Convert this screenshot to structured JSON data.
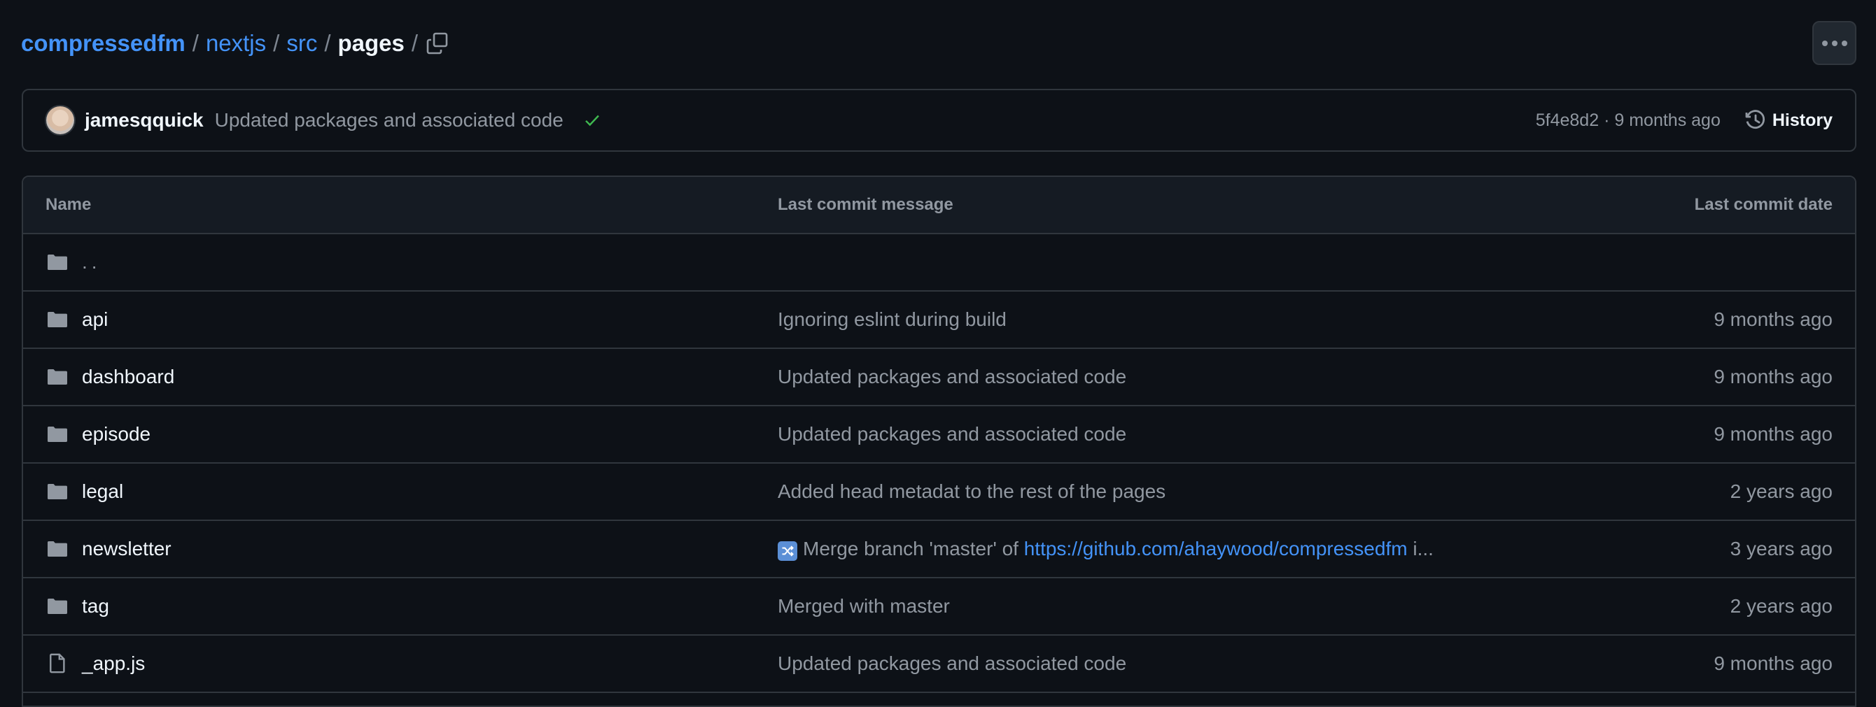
{
  "breadcrumb": {
    "items": [
      {
        "label": "compressedfm",
        "type": "repo"
      },
      {
        "label": "nextjs",
        "type": "dir"
      },
      {
        "label": "src",
        "type": "dir"
      }
    ],
    "current": "pages",
    "separator": "/"
  },
  "icons": {
    "copy": "copy-path-icon",
    "more": "kebab-horizontal-icon"
  },
  "latest_commit": {
    "author": "jamesqquick",
    "message": "Updated packages and associated code",
    "status": "success",
    "sha": "5f4e8d2",
    "separator": "·",
    "time": "9 months ago",
    "history_label": "History"
  },
  "table": {
    "headers": {
      "name": "Name",
      "message": "Last commit message",
      "date": "Last commit date"
    },
    "rows": [
      {
        "type": "parent",
        "name": "..",
        "message": "",
        "date": ""
      },
      {
        "type": "dir",
        "name": "api",
        "message": "Ignoring eslint during build",
        "date": "9 months ago"
      },
      {
        "type": "dir",
        "name": "dashboard",
        "message": "Updated packages and associated code",
        "date": "9 months ago"
      },
      {
        "type": "dir",
        "name": "episode",
        "message": "Updated packages and associated code",
        "date": "9 months ago"
      },
      {
        "type": "dir",
        "name": "legal",
        "message": "Added head metadat to the rest of the pages",
        "date": "2 years ago"
      },
      {
        "type": "dir",
        "name": "newsletter",
        "message_prefix": "Merge branch 'master' of ",
        "message_link": "https://github.com/ahaywood/compressedfm",
        "message_suffix": " i...",
        "message_emoji": "shuffle",
        "date": "3 years ago"
      },
      {
        "type": "dir",
        "name": "tag",
        "message": "Merged with master",
        "date": "2 years ago"
      },
      {
        "type": "file",
        "name": "_app.js",
        "message": "Updated packages and associated code",
        "date": "9 months ago"
      }
    ]
  },
  "colors": {
    "background": "#0d1117",
    "border": "#30363d",
    "link": "#4493f8",
    "muted": "#9198a1",
    "success": "#3fb950"
  }
}
